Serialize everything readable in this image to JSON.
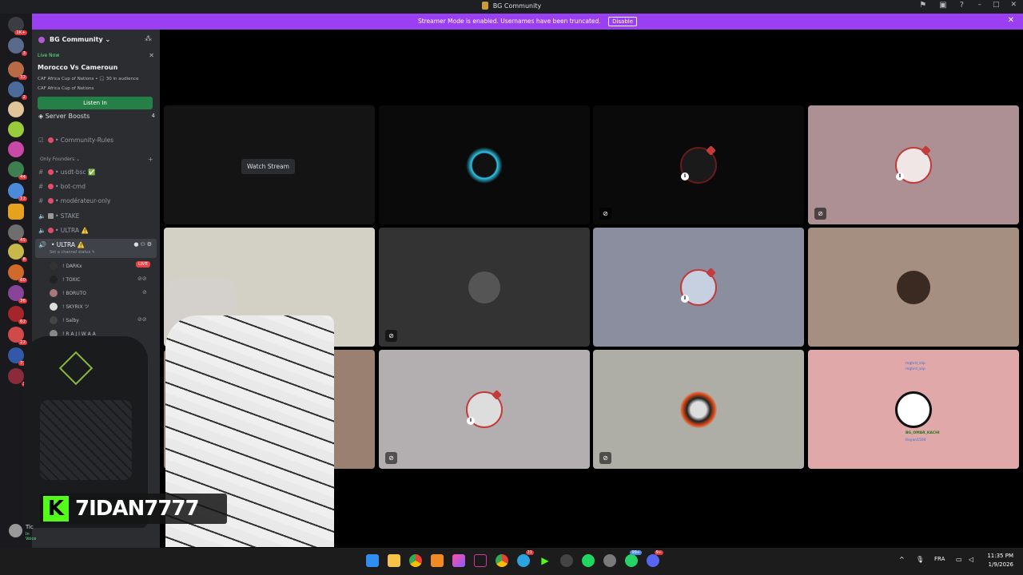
{
  "window": {
    "title": "BG Community"
  },
  "banner": {
    "message": "Streamer Mode is enabled. Usernames have been truncated.",
    "button": "Disable"
  },
  "server_rail": {
    "badges": [
      "1K+",
      "3",
      "32",
      "2",
      "44",
      "12",
      "45",
      "8",
      "60",
      "36",
      "62",
      "22",
      "77",
      "3"
    ]
  },
  "server_header": {
    "name": "BG Community ⌄"
  },
  "live_card": {
    "status": "Live Now",
    "topic": "Morocco Vs Cameroun",
    "meta": "CAF Africa Cup of Nations • 🎧 30 in audience",
    "meta2": "CAF Africa Cup of Nations",
    "button": "Listen In"
  },
  "server_boosts": {
    "label": "Server Boosts",
    "count": "4"
  },
  "channels": [
    {
      "icon": "☑",
      "name": "• Community-Rules"
    },
    {
      "icon": "#",
      "name": "• usdt-bsc ✅"
    },
    {
      "icon": "#",
      "name": "• bot-cmd"
    },
    {
      "icon": "#",
      "name": "• modérateur-only"
    },
    {
      "icon": "🔈",
      "name": "• STAKE"
    },
    {
      "icon": "🔈",
      "name": "• ULTRA ⚠️"
    }
  ],
  "category": {
    "label": "Only Founders ⌄",
    "add": "+"
  },
  "active_channel": {
    "name": "• ULTRA ⚠️",
    "status": "Set a channel status ✎"
  },
  "members": [
    {
      "name": "! DARKx",
      "live": "LIVE"
    },
    {
      "name": "! TOXIC"
    },
    {
      "name": "! BORUTO"
    },
    {
      "name": "! SKYRIX ツ"
    },
    {
      "name": "! Salby"
    },
    {
      "name": "! R A J I W A A"
    }
  ],
  "stage": {
    "watch_stream": "Watch Stream"
  },
  "chat_overlay": {
    "lines": [
      "mghrd_slip",
      "mghrd_slip",
      "BG_OMAR_KACHI",
      "Rayan1504"
    ]
  },
  "overlay": {
    "kick_letter": "K",
    "streamer_name": "7IDAN7777"
  },
  "user_panel": {
    "name": "Tic",
    "status": "In Voice"
  },
  "taskbar": {
    "notif_badges": [
      "21",
      "99+",
      "9+"
    ],
    "language": "FRA",
    "time": "11:35 PM",
    "date": "1/9/2026"
  }
}
